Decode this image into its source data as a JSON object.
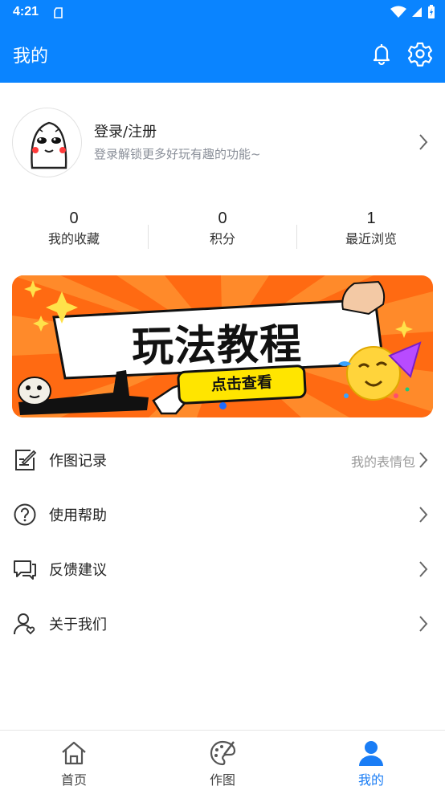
{
  "status": {
    "time": "4:21"
  },
  "appbar": {
    "title": "我的"
  },
  "profile": {
    "title": "登录/注册",
    "subtitle": "登录解锁更多好玩有趣的功能~"
  },
  "stats": [
    {
      "value": "0",
      "label": "我的收藏"
    },
    {
      "value": "0",
      "label": "积分"
    },
    {
      "value": "1",
      "label": "最近浏览"
    }
  ],
  "banner": {
    "title": "玩法教程",
    "button": "点击查看"
  },
  "menu": [
    {
      "label": "作图记录",
      "extra": "我的表情包",
      "icon": "edit-record-icon"
    },
    {
      "label": "使用帮助",
      "icon": "help-icon"
    },
    {
      "label": "反馈建议",
      "icon": "feedback-icon"
    },
    {
      "label": "关于我们",
      "icon": "about-icon"
    }
  ],
  "nav": [
    {
      "label": "首页",
      "icon": "home-icon"
    },
    {
      "label": "作图",
      "icon": "palette-icon"
    },
    {
      "label": "我的",
      "icon": "user-icon",
      "active": true
    }
  ],
  "colors": {
    "primary": "#0a84ff",
    "active": "#1a7df5",
    "banner_bg": "#ff6a12",
    "banner_button": "#ffe500"
  }
}
